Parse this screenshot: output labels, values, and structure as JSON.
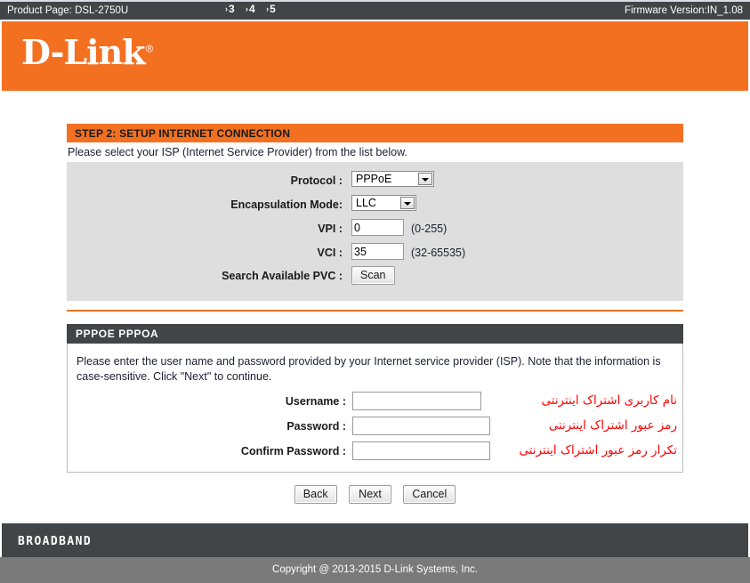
{
  "topbar": {
    "product_page": "Product Page: DSL-2750U",
    "firmware": "Firmware Version:IN_1.08"
  },
  "brand": {
    "logo_text": "D-Link",
    "registered_mark": "®"
  },
  "step": {
    "title": "STEP 2: SETUP INTERNET CONNECTION",
    "crumbs": [
      "3",
      "4",
      "5"
    ],
    "crumb_arrow": "›",
    "intro": "Please select your ISP (Internet Service Provider) from the list below."
  },
  "isp_form": {
    "protocol": {
      "label": "Protocol :",
      "value": "PPPoE"
    },
    "encapsulation": {
      "label": "Encapsulation Mode:",
      "value": "LLC"
    },
    "vpi": {
      "label": "VPI :",
      "value": "0",
      "hint": "(0-255)"
    },
    "vci": {
      "label": "VCI :",
      "value": "35",
      "hint": "(32-65535)"
    },
    "search_pvc": {
      "label": "Search Available PVC :",
      "button": "Scan"
    }
  },
  "pppoe_section": {
    "header": "PPPOE PPPOA",
    "description": "Please enter the user name and password provided by your Internet service provider (ISP). Note that the information is case-sensitive. Click \"Next\" to continue.",
    "fields": [
      {
        "label": "Username :",
        "value": "",
        "note_fa": "نام کاربری اشتراک اینترنتی"
      },
      {
        "label": "Password :",
        "value": "",
        "note_fa": "رمز عبور اشتراک اینترنتی"
      },
      {
        "label": "Confirm Password :",
        "value": "",
        "note_fa": "تکرار رمز عبور اشتراک اینترنتی"
      }
    ]
  },
  "actions": {
    "back": "Back",
    "next": "Next",
    "cancel": "Cancel"
  },
  "footer": {
    "broadband": "BROADBAND",
    "copyright": "Copyright @ 2013-2015 D-Link Systems, Inc."
  },
  "colors": {
    "orange": "#f37021",
    "dark": "#414547",
    "panel_gray": "#dedede",
    "note_red": "#ff0000"
  }
}
